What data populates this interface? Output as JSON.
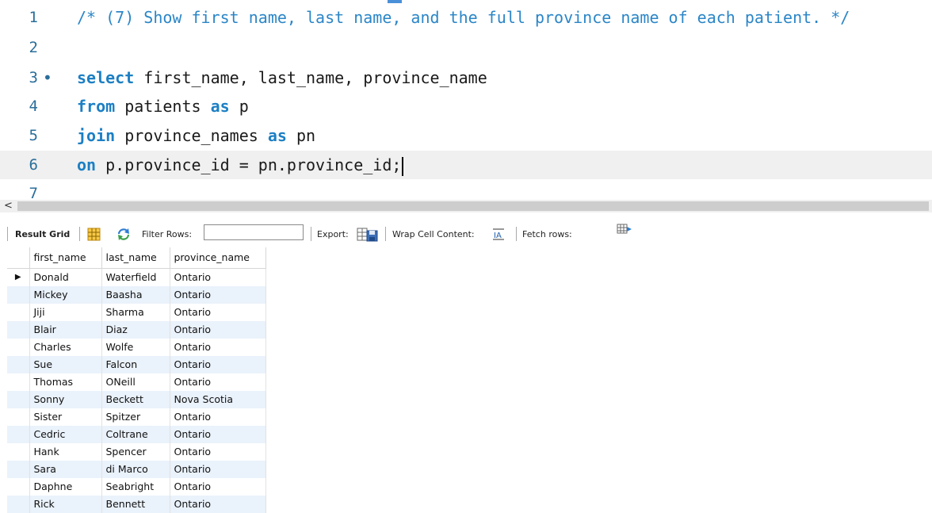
{
  "editor": {
    "lines": [
      {
        "num": "1",
        "marker": "",
        "comment": "/* (7) Show first name, last name, and the full province name of each patient. */"
      },
      {
        "num": "2",
        "marker": ""
      },
      {
        "num": "3",
        "marker": "•",
        "kw": "select",
        "rest": " first_name, last_name, province_name"
      },
      {
        "num": "4",
        "marker": "",
        "kw": "from",
        "rest": " patients ",
        "kw2": "as",
        "rest2": " p"
      },
      {
        "num": "5",
        "marker": "",
        "kw": "join",
        "rest": " province_names ",
        "kw2": "as",
        "rest2": " pn"
      },
      {
        "num": "6",
        "marker": "",
        "kw": "on",
        "rest": " p.province_id = pn.province_id;"
      },
      {
        "num": "7",
        "marker": ""
      }
    ]
  },
  "scrollbar": {
    "left_arrow": "<"
  },
  "toolbar": {
    "result_grid": "Result Grid",
    "filter_label": "Filter Rows:",
    "filter_value": "",
    "export_label": "Export:",
    "wrap_label": "Wrap Cell Content:",
    "fetch_label": "Fetch rows:"
  },
  "grid": {
    "current_row_marker": "▶",
    "columns": [
      "first_name",
      "last_name",
      "province_name"
    ],
    "rows": [
      [
        "Donald",
        "Waterfield",
        "Ontario"
      ],
      [
        "Mickey",
        "Baasha",
        "Ontario"
      ],
      [
        "Jiji",
        "Sharma",
        "Ontario"
      ],
      [
        "Blair",
        "Diaz",
        "Ontario"
      ],
      [
        "Charles",
        "Wolfe",
        "Ontario"
      ],
      [
        "Sue",
        "Falcon",
        "Ontario"
      ],
      [
        "Thomas",
        "ONeill",
        "Ontario"
      ],
      [
        "Sonny",
        "Beckett",
        "Nova Scotia"
      ],
      [
        "Sister",
        "Spitzer",
        "Ontario"
      ],
      [
        "Cedric",
        "Coltrane",
        "Ontario"
      ],
      [
        "Hank",
        "Spencer",
        "Ontario"
      ],
      [
        "Sara",
        "di Marco",
        "Ontario"
      ],
      [
        "Daphne",
        "Seabright",
        "Ontario"
      ],
      [
        "Rick",
        "Bennett",
        "Ontario"
      ]
    ]
  }
}
